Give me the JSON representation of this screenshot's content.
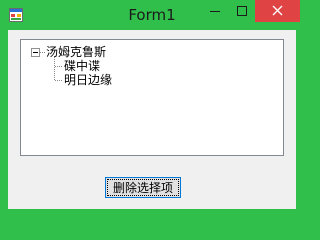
{
  "window": {
    "title": "Form1",
    "colors": {
      "titlebar": "#2fbf4a",
      "close_button": "#e04343",
      "client_bg": "#f0f0f0"
    }
  },
  "titlebar": {
    "icons": [
      "app-icon",
      "minimize-icon",
      "maximize-icon",
      "close-icon"
    ]
  },
  "tree": {
    "root": {
      "label": "汤姆克鲁斯",
      "expanded": true,
      "children": [
        {
          "label": "碟中谍"
        },
        {
          "label": "明日边缘"
        }
      ]
    }
  },
  "actions": {
    "delete_label": "删除选择项"
  }
}
